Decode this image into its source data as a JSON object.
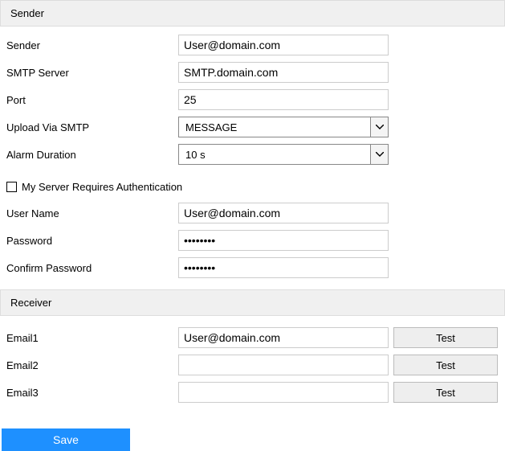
{
  "sender": {
    "header": "Sender",
    "fields": {
      "sender_label": "Sender",
      "sender_value": "User@domain.com",
      "smtp_server_label": "SMTP Server",
      "smtp_server_value": "SMTP.domain.com",
      "port_label": "Port",
      "port_value": "25",
      "upload_label": "Upload Via SMTP",
      "upload_value": "MESSAGE",
      "alarm_label": "Alarm Duration",
      "alarm_value": "10 s",
      "auth_checkbox_label": "My Server Requires Authentication",
      "auth_checked": false,
      "username_label": "User Name",
      "username_value": "User@domain.com",
      "password_label": "Password",
      "password_value": "********",
      "confirm_label": "Confirm Password",
      "confirm_value": "********"
    }
  },
  "receiver": {
    "header": "Receiver",
    "test_label": "Test",
    "emails": [
      {
        "label": "Email1",
        "value": "User@domain.com"
      },
      {
        "label": "Email2",
        "value": ""
      },
      {
        "label": "Email3",
        "value": ""
      }
    ]
  },
  "save_label": "Save"
}
